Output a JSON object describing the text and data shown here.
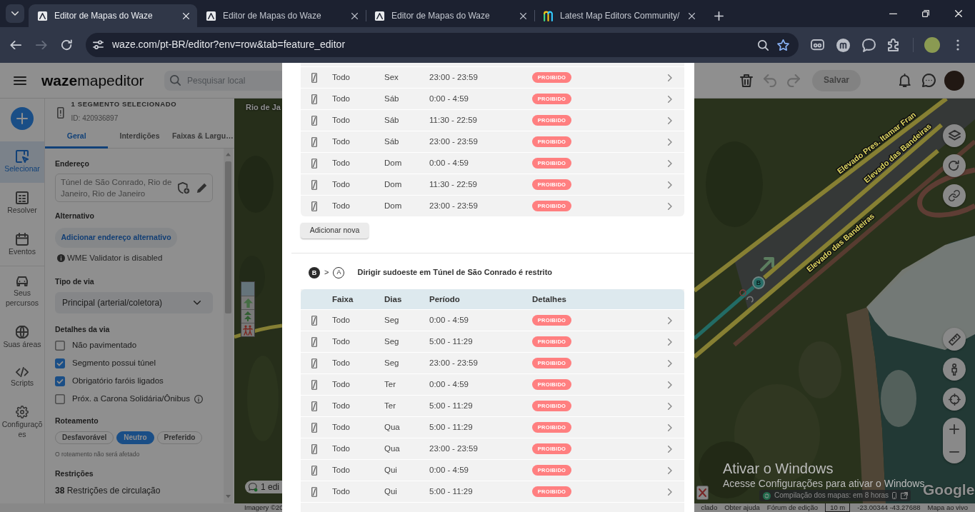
{
  "browser": {
    "tabs": [
      {
        "kind": "editor",
        "title": "Editor de Mapas do Waze",
        "selected": true
      },
      {
        "kind": "editor",
        "title": "Editor de Mapas do Waze",
        "selected": false
      },
      {
        "kind": "editor",
        "title": "Editor de Mapas do Waze",
        "selected": false
      },
      {
        "kind": "forum",
        "title": "Latest Map Editors Community/",
        "selected": false
      }
    ],
    "forward_disabled": true,
    "url": "waze.com/pt-BR/editor?env=row&tab=feature_editor",
    "bookmarked": true
  },
  "topbar": {
    "logo": "**waze**mapeditor",
    "search": {
      "placeholder": "Pesquisar local"
    },
    "actions": [
      {
        "kind": "delete",
        "disabled": false
      },
      {
        "kind": "undo",
        "disabled": true
      },
      {
        "kind": "redo",
        "disabled": true
      }
    ],
    "save": {
      "label": "Salvar",
      "disabled": true
    }
  },
  "rail": {
    "groups": [
      [
        {
          "kind": "select",
          "label": "Selecionar",
          "selected": true
        },
        {
          "kind": "solve",
          "label": "Resolver",
          "selected": false
        },
        {
          "kind": "events",
          "label": "Eventos",
          "selected": false
        }
      ],
      [
        {
          "kind": "drives",
          "label": "Seus percursos",
          "selected": false
        },
        {
          "kind": "areas",
          "label": "Suas áreas",
          "selected": false
        },
        {
          "kind": "scripts",
          "label": "Scripts",
          "selected": false
        },
        {
          "kind": "settings",
          "label": "Configurações",
          "selected": false
        }
      ]
    ]
  },
  "panel": {
    "title": "1 SEGMENTO SELECIONADO",
    "subtitle": "ID: 420936897",
    "tabs": [
      {
        "label": "Geral",
        "selected": true
      },
      {
        "label": "Interdições",
        "selected": false
      },
      {
        "label": "Faixas & Largu…",
        "selected": false
      }
    ],
    "address": {
      "label": "Endereço",
      "value": "Túnel de São Conrado, Rio de Janeiro, Rio de Janeiro"
    },
    "alternative": {
      "label": "Alternativo",
      "button": "Adicionar endereço alternativo",
      "notice": "WME Validator is disabled"
    },
    "road_type": {
      "label": "Tipo de via",
      "value": "Principal (arterial/coletora)"
    },
    "details": {
      "label": "Detalhes da via",
      "options": [
        {
          "label": "Não pavimentado",
          "checked": false
        },
        {
          "label": "Segmento possui túnel",
          "checked": true
        },
        {
          "label": "Obrigatório faróis ligados",
          "checked": true
        },
        {
          "label": "Próx. a Carona Solidária/Ônibus",
          "checked": false,
          "info": true
        }
      ]
    },
    "routing": {
      "label": "Roteamento",
      "options": [
        {
          "label": "Desfavorável",
          "selected": false
        },
        {
          "label": "Neutro",
          "selected": true
        },
        {
          "label": "Preferido",
          "selected": false
        }
      ],
      "note": "O roteamento não será afetado"
    },
    "restrictions": {
      "label": "Restrições",
      "summary": "**38** Restrições de circulação"
    }
  },
  "map": {
    "place_label": "Rio de Ja",
    "roads": [
      {
        "label": "Elevado Pres. Itamar Fran"
      },
      {
        "label": "Elevado das Bandeiras"
      },
      {
        "label": "Elevado das Bandeiras"
      }
    ],
    "node_label": "B",
    "editors": "1 edi",
    "build_notice": "Compilação dos mapas: em 8 horas",
    "provider_logo": "Google",
    "footer": {
      "attribution": "Imagery ©20",
      "links": [
        "clado",
        "Obter ajuda",
        "Fórum de edição"
      ],
      "scale": "10 m",
      "coordinates": "-23.00344 -43.27688",
      "live_map": "Mapa ao vivo"
    }
  },
  "dialog": {
    "sections": [
      {
        "rows": [
          {
            "lane": "Todo",
            "days": "Sex",
            "period": "23:00 - 23:59",
            "status": "PROIBIDO"
          },
          {
            "lane": "Todo",
            "days": "Sáb",
            "period": "0:00 - 4:59",
            "status": "PROIBIDO"
          },
          {
            "lane": "Todo",
            "days": "Sáb",
            "period": "11:30 - 22:59",
            "status": "PROIBIDO"
          },
          {
            "lane": "Todo",
            "days": "Sáb",
            "period": "23:00 - 23:59",
            "status": "PROIBIDO"
          },
          {
            "lane": "Todo",
            "days": "Dom",
            "period": "0:00 - 4:59",
            "status": "PROIBIDO"
          },
          {
            "lane": "Todo",
            "days": "Dom",
            "period": "11:30 - 22:59",
            "status": "PROIBIDO"
          },
          {
            "lane": "Todo",
            "days": "Dom",
            "period": "23:00 - 23:59",
            "status": "PROIBIDO"
          }
        ],
        "add_label": "Adicionar nova"
      },
      {
        "from": "B",
        "separator": ">",
        "to": "A",
        "title": "Dirigir sudoeste em Túnel de São Conrado é restrito",
        "columns": [
          "Faixa",
          "Dias",
          "Período",
          "Detalhes"
        ],
        "rows": [
          {
            "lane": "Todo",
            "days": "Seg",
            "period": "0:00 - 4:59",
            "status": "PROIBIDO"
          },
          {
            "lane": "Todo",
            "days": "Seg",
            "period": "5:00 - 11:29",
            "status": "PROIBIDO"
          },
          {
            "lane": "Todo",
            "days": "Seg",
            "period": "23:00 - 23:59",
            "status": "PROIBIDO"
          },
          {
            "lane": "Todo",
            "days": "Ter",
            "period": "0:00 - 4:59",
            "status": "PROIBIDO"
          },
          {
            "lane": "Todo",
            "days": "Ter",
            "period": "5:00 - 11:29",
            "status": "PROIBIDO"
          },
          {
            "lane": "Todo",
            "days": "Qua",
            "period": "5:00 - 11:29",
            "status": "PROIBIDO"
          },
          {
            "lane": "Todo",
            "days": "Qua",
            "period": "23:00 - 23:59",
            "status": "PROIBIDO"
          },
          {
            "lane": "Todo",
            "days": "Qui",
            "period": "0:00 - 4:59",
            "status": "PROIBIDO"
          },
          {
            "lane": "Todo",
            "days": "Qui",
            "period": "5:00 - 11:29",
            "status": "PROIBIDO"
          }
        ]
      }
    ]
  },
  "os_notice": {
    "title": "Ativar o Windows",
    "message": "Acesse Configurações para ativar o Windows"
  }
}
